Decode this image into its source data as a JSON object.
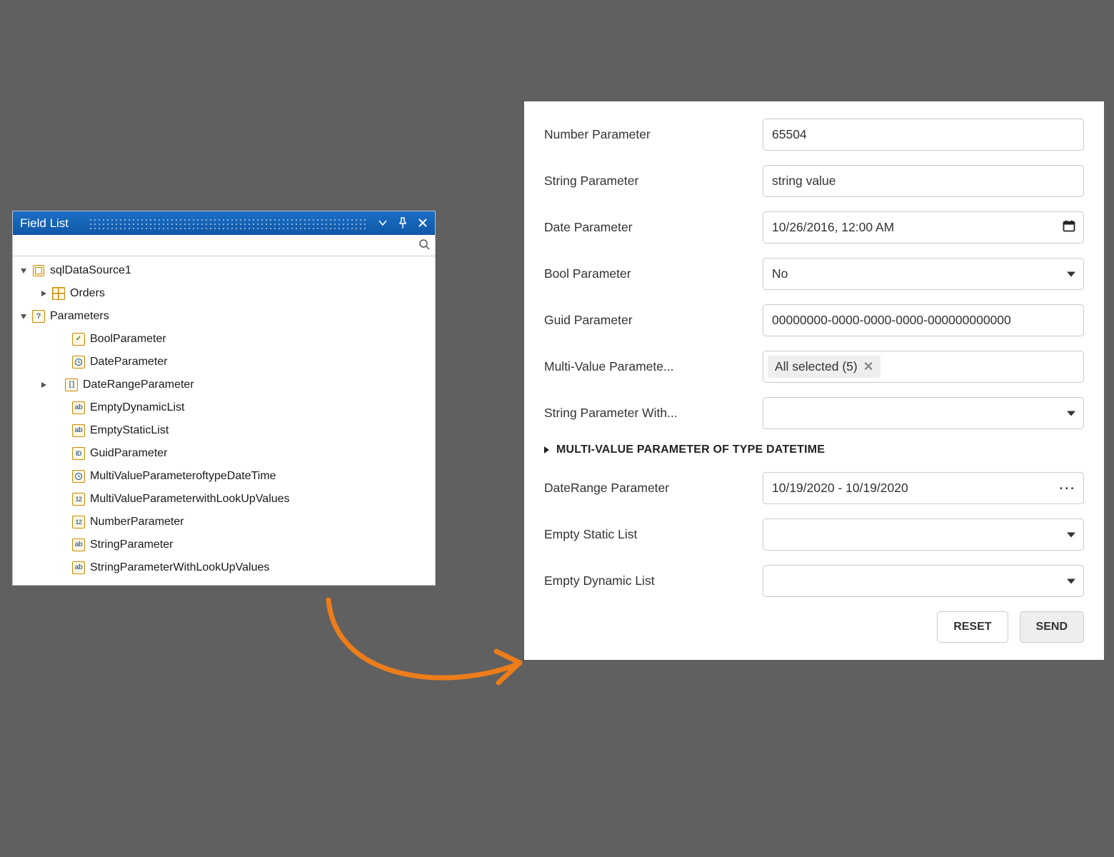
{
  "fieldList": {
    "title": "Field List",
    "searchPlaceholder": "",
    "tree": {
      "dataSource": {
        "label": "sqlDataSource1"
      },
      "orders": {
        "label": "Orders"
      },
      "parametersNode": {
        "label": "Parameters"
      },
      "params": [
        {
          "icon": "check",
          "label": "BoolParameter"
        },
        {
          "icon": "clock",
          "label": "DateParameter"
        },
        {
          "icon": "brackets",
          "label": "DateRangeParameter",
          "hasChildren": true
        },
        {
          "icon": "ab",
          "label": "EmptyDynamicList"
        },
        {
          "icon": "ab",
          "label": "EmptyStaticList"
        },
        {
          "icon": "id",
          "label": "GuidParameter"
        },
        {
          "icon": "clock",
          "label": "MultiValueParameteroftypeDateTime"
        },
        {
          "icon": "n12",
          "label": "MultiValueParameterwithLookUpValues"
        },
        {
          "icon": "n12",
          "label": "NumberParameter"
        },
        {
          "icon": "ab",
          "label": "StringParameter"
        },
        {
          "icon": "ab",
          "label": "StringParameterWithLookUpValues"
        }
      ]
    }
  },
  "paramsPanel": {
    "rows": {
      "number": {
        "label": "Number Parameter",
        "value": "65504"
      },
      "string": {
        "label": "String Parameter",
        "value": "string value"
      },
      "date": {
        "label": "Date Parameter",
        "value": "10/26/2016, 12:00 AM"
      },
      "bool": {
        "label": "Bool Parameter",
        "value": "No"
      },
      "guid": {
        "label": "Guid Parameter",
        "value": "00000000-0000-0000-0000-000000000000"
      },
      "multi": {
        "label": "Multi-Value Paramete...",
        "chip": "All selected (5)"
      },
      "stringLU": {
        "label": "String Parameter With...",
        "value": ""
      },
      "section": {
        "label": "MULTI-VALUE PARAMETER OF TYPE DATETIME"
      },
      "dateRange": {
        "label": "DateRange Parameter",
        "value": "10/19/2020 - 10/19/2020"
      },
      "emptyStatic": {
        "label": "Empty Static List",
        "value": ""
      },
      "emptyDynamic": {
        "label": "Empty Dynamic List",
        "value": ""
      }
    },
    "buttons": {
      "reset": "RESET",
      "send": "SEND"
    }
  }
}
